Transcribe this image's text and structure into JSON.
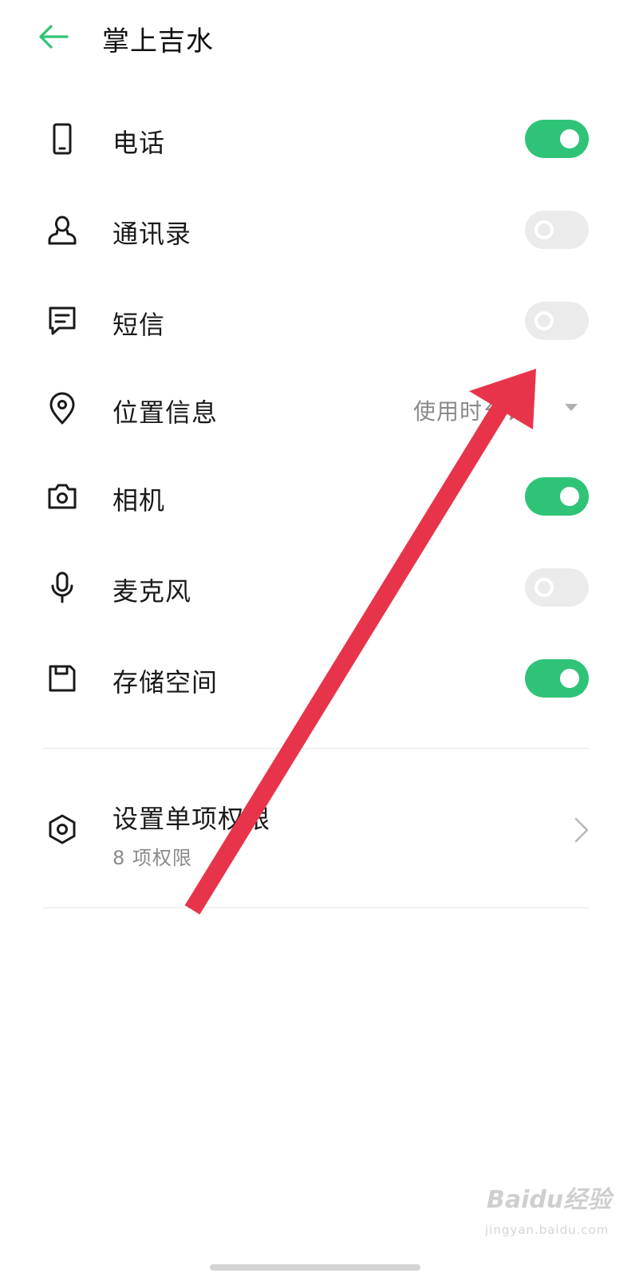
{
  "header": {
    "title": "掌上吉水"
  },
  "permissions": [
    {
      "label": "电话",
      "icon": "phone-icon",
      "state": "on"
    },
    {
      "label": "通讯录",
      "icon": "contact-icon",
      "state": "off"
    },
    {
      "label": "短信",
      "icon": "message-icon",
      "state": "off"
    },
    {
      "label": "位置信息",
      "icon": "location-icon",
      "dropdown": "使用时允许"
    },
    {
      "label": "相机",
      "icon": "camera-icon",
      "state": "on"
    },
    {
      "label": "麦克风",
      "icon": "microphone-icon",
      "state": "off"
    },
    {
      "label": "存储空间",
      "icon": "storage-icon",
      "state": "on"
    }
  ],
  "single_permission": {
    "label": "设置单项权限",
    "sub": "8 项权限",
    "icon": "hexagon-settings-icon"
  },
  "colors": {
    "accent": "#2fc377",
    "toggle_off": "#ebebeb",
    "annotation_arrow": "#e8344a"
  },
  "watermark": {
    "brand": "Baidu经验",
    "url": "jingyan.baidu.com"
  }
}
